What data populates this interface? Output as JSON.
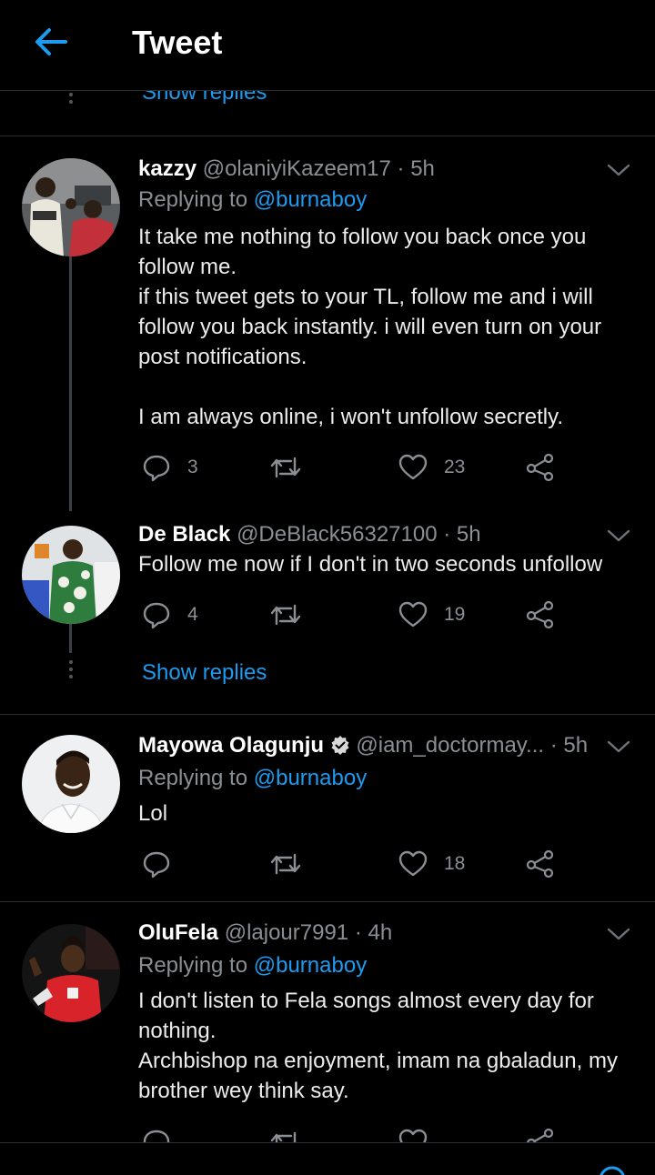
{
  "header": {
    "title": "Tweet"
  },
  "prev_thread": {
    "show_replies": "Show replies"
  },
  "tweets": [
    {
      "name": "kazzy",
      "handle": "@olaniyiKazeem17",
      "time": "· 5h",
      "replying_prefix": "Replying to",
      "replying_to": "@burnaboy",
      "lines": [
        "It take me nothing to follow you back once you follow me.",
        "if this tweet gets to your TL, follow me and i will follow you back instantly. i will even turn on your post notifications.",
        "",
        "I am always online, i won't unfollow secretly."
      ],
      "replies": "3",
      "retweets": "",
      "likes": "23"
    },
    {
      "name": "De Black",
      "handle": "@DeBlack56327100",
      "time": "· 5h",
      "lines": [
        "Follow me now if I don't in two seconds unfollow"
      ],
      "replies": "4",
      "retweets": "",
      "likes": "19",
      "show_replies": "Show replies"
    },
    {
      "name": "Mayowa Olagunju",
      "verified": true,
      "handle": "@iam_doctormay...",
      "time": "· 5h",
      "replying_prefix": "Replying to",
      "replying_to": "@burnaboy",
      "lines": [
        "Lol"
      ],
      "replies": "",
      "retweets": "",
      "likes": "18"
    },
    {
      "name": "OluFela",
      "handle": "@lajour7991",
      "time": "· 4h",
      "replying_prefix": "Replying to",
      "replying_to": "@burnaboy",
      "lines": [
        "I don't listen to Fela songs almost every day for nothing.",
        "Archbishop na enjoyment, imam na gbaladun, my brother wey think say."
      ]
    }
  ],
  "colors": {
    "accent": "#1d9bf0",
    "muted": "#8b8f94",
    "background": "#000000",
    "separator": "#2b2f33"
  },
  "icons": [
    "back-arrow-icon",
    "chevron-down-icon",
    "reply-icon",
    "retweet-icon",
    "like-icon",
    "share-icon",
    "verified-icon"
  ]
}
